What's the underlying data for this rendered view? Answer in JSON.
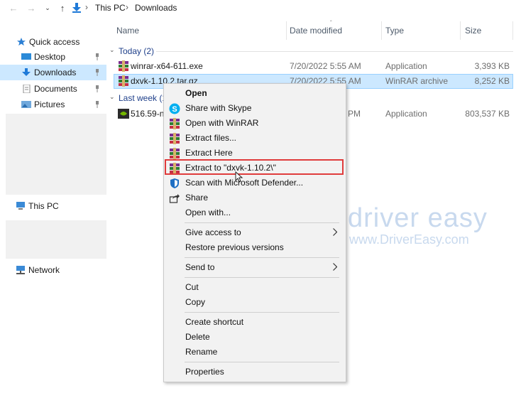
{
  "address": {
    "path": [
      "This PC",
      "Downloads"
    ],
    "back_icon": "back-arrow-icon",
    "forward_icon": "forward-arrow-icon",
    "recent_icon": "chevron-down-icon",
    "up_icon": "up-arrow-icon"
  },
  "sidebar": {
    "quick_access": "Quick access",
    "items": [
      {
        "label": "Desktop",
        "icon": "desktop-icon",
        "pinned": true
      },
      {
        "label": "Downloads",
        "icon": "downloads-icon",
        "pinned": true,
        "selected": true
      },
      {
        "label": "Documents",
        "icon": "documents-icon",
        "pinned": true
      },
      {
        "label": "Pictures",
        "icon": "pictures-icon",
        "pinned": true
      }
    ],
    "this_pc": "This PC",
    "network": "Network"
  },
  "columns": {
    "name": "Name",
    "date_modified": "Date modified",
    "type": "Type",
    "size": "Size"
  },
  "groups": [
    {
      "label": "Today (2)",
      "files": [
        {
          "name": "winrar-x64-611.exe",
          "date": "7/20/2022 5:55 AM",
          "type": "Application",
          "size": "3,393 KB"
        },
        {
          "name": "dxvk-1.10.2.tar.gz",
          "date": "7/20/2022 5:55 AM",
          "type": "WinRAR archive",
          "size": "8,252 KB",
          "selected": true
        }
      ]
    },
    {
      "label": "Last week (1",
      "files": [
        {
          "name": "516.59-n",
          "date": "PM",
          "type": "Application",
          "size": "803,537 KB"
        }
      ]
    }
  ],
  "context_menu": {
    "open": "Open",
    "share_skype": "Share with Skype",
    "open_winrar": "Open with WinRAR",
    "extract_files": "Extract files...",
    "extract_here": "Extract Here",
    "extract_to": "Extract to \"dxvk-1.10.2\\\"",
    "scan_defender": "Scan with Microsoft Defender...",
    "share": "Share",
    "open_with": "Open with...",
    "give_access": "Give access to",
    "restore_versions": "Restore previous versions",
    "send_to": "Send to",
    "cut": "Cut",
    "copy": "Copy",
    "create_shortcut": "Create shortcut",
    "delete": "Delete",
    "rename": "Rename",
    "properties": "Properties"
  },
  "watermark": {
    "title": "driver easy",
    "url": "www.DriverEasy.com"
  },
  "colors": {
    "selection": "#cce8ff",
    "highlight_box": "#e03c3c",
    "group_text": "#1e3f8a",
    "watermark": "#c8d9ee"
  }
}
